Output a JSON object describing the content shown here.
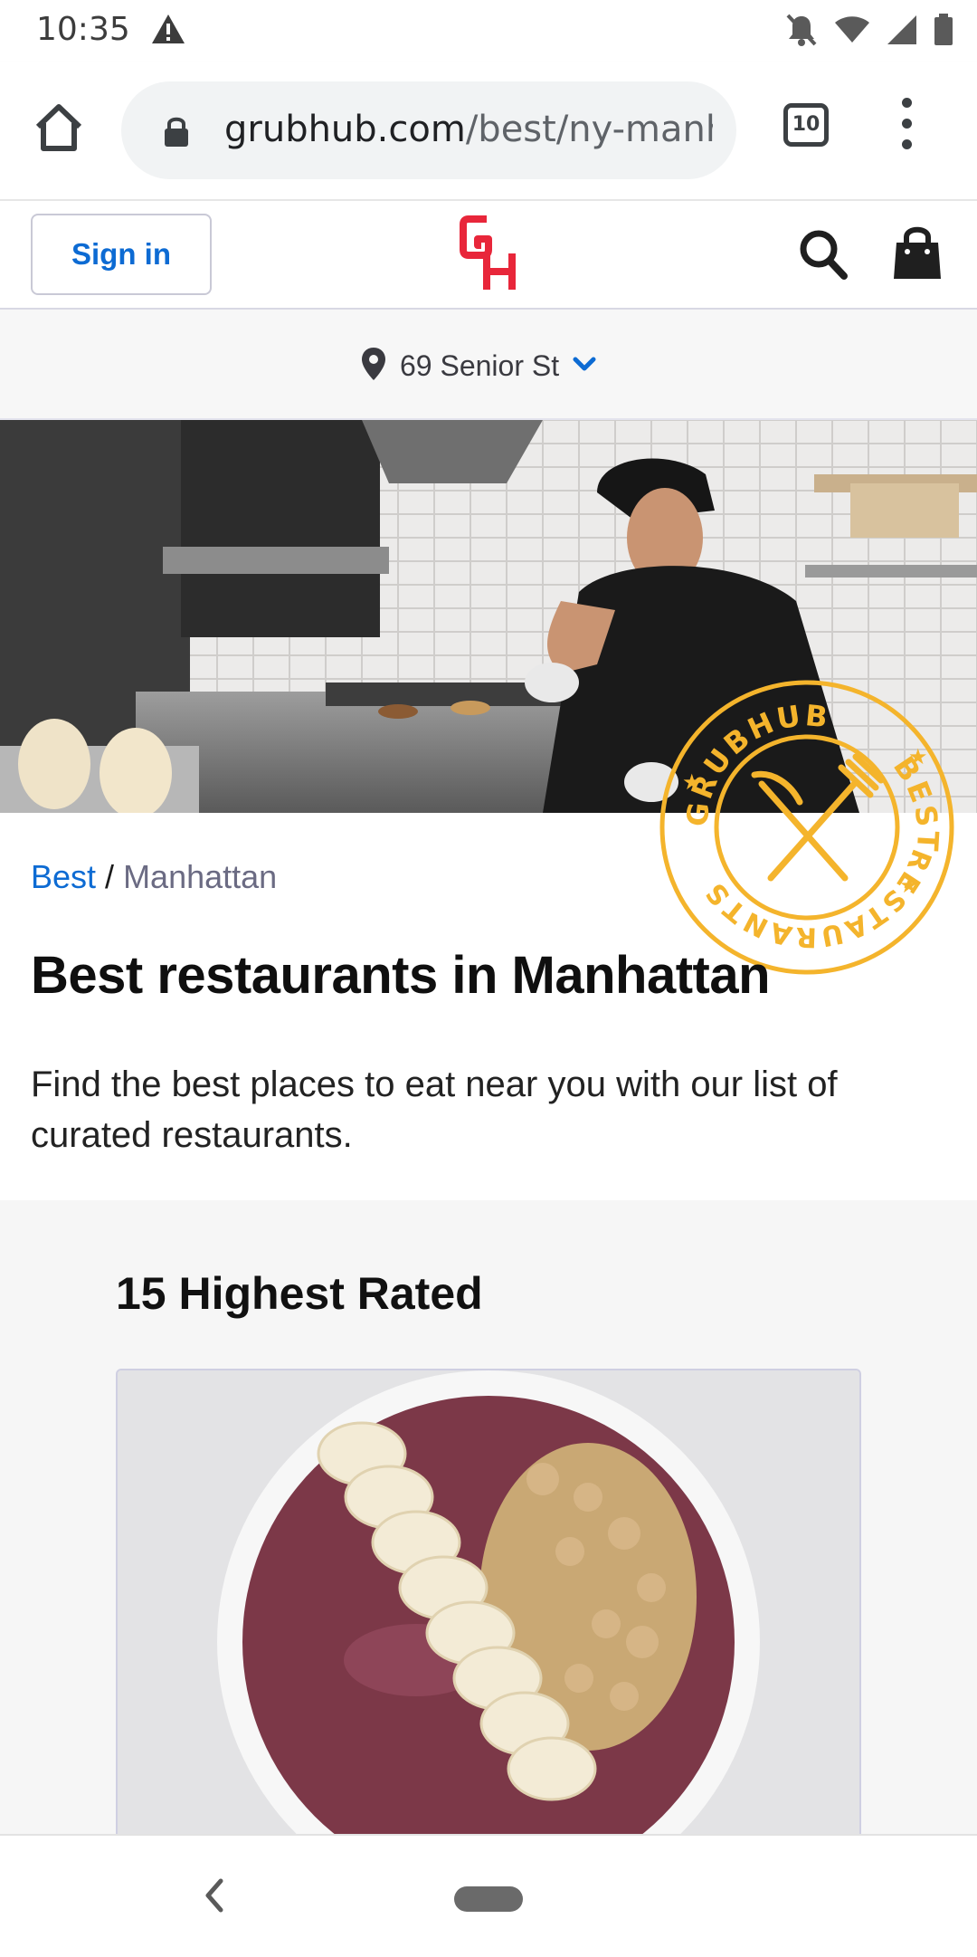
{
  "status_bar": {
    "time": "10:35",
    "icons": [
      "warning-icon",
      "mute-icon",
      "wifi-icon",
      "signal-icon",
      "battery-icon"
    ]
  },
  "browser": {
    "url_domain": "grubhub.com",
    "url_path": "/best/ny-manh",
    "tab_count": "10",
    "icons": [
      "home-icon",
      "lock-icon",
      "more-vert-icon"
    ]
  },
  "header": {
    "sign_in_label": "Sign in",
    "logo_text": "GH",
    "icons": [
      "search-icon",
      "shopping-bag-icon"
    ]
  },
  "address": {
    "label": "69 Senior St",
    "icons": [
      "location-pin-icon",
      "chevron-down-icon"
    ]
  },
  "badge": {
    "text_top": "GRUBHUB",
    "text_right": "BEST",
    "text_bottom": "RESTAURANTS"
  },
  "breadcrumb": {
    "link": "Best",
    "separator": "/",
    "current": "Manhattan"
  },
  "page": {
    "title": "Best restaurants in Manhattan",
    "description": "Find the best places to eat near you with our list of curated restaurants."
  },
  "list": {
    "section_title": "15 Highest Rated"
  },
  "colors": {
    "brand_red": "#e8263a",
    "link_blue": "#0d6bd3",
    "badge_gold": "#f4b42c"
  }
}
